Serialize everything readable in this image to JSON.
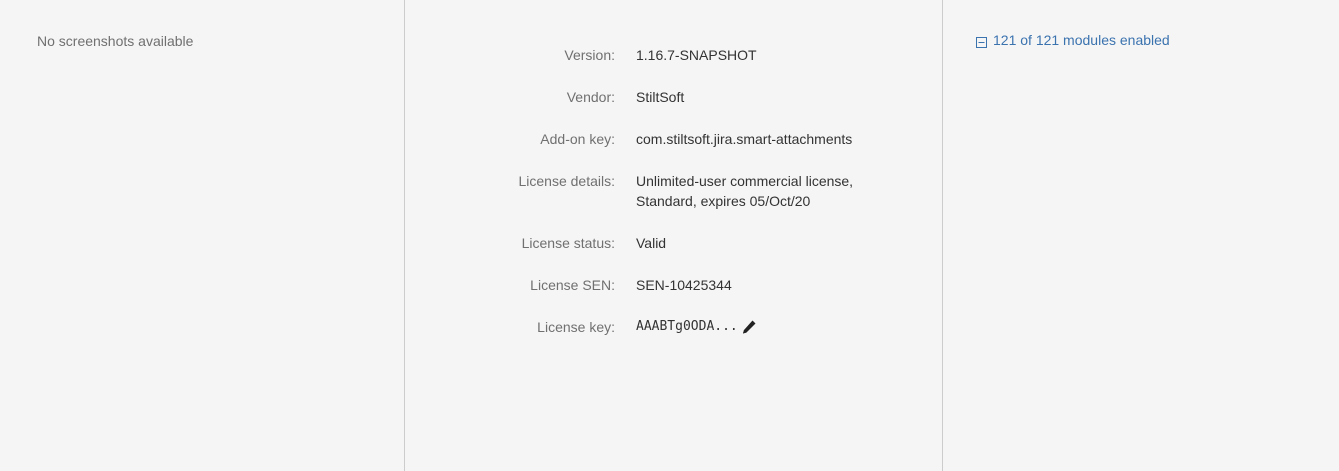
{
  "screenshots": {
    "empty_text": "No screenshots available"
  },
  "details": {
    "rows": [
      {
        "label": "Version:",
        "value": "1.16.7-SNAPSHOT"
      },
      {
        "label": "Vendor:",
        "value": "StiltSoft"
      },
      {
        "label": "Add-on key:",
        "value": "com.stiltsoft.jira.smart-attachments"
      },
      {
        "label": "License details:",
        "value": "Unlimited-user commercial license, Standard, expires 05/Oct/20"
      },
      {
        "label": "License status:",
        "value": "Valid"
      },
      {
        "label": "License SEN:",
        "value": "SEN-10425344"
      },
      {
        "label": "License key:",
        "value": "AAABTg0ODA..."
      }
    ]
  },
  "modules": {
    "link_text": "121 of 121 modules enabled",
    "icon": "collapse-icon"
  },
  "icons": {
    "license_key_edit": "pencil-icon"
  },
  "colors": {
    "link": "#3b73af",
    "label": "#707070",
    "value": "#333333",
    "background": "#f5f5f5",
    "divider": "#cccccc"
  }
}
